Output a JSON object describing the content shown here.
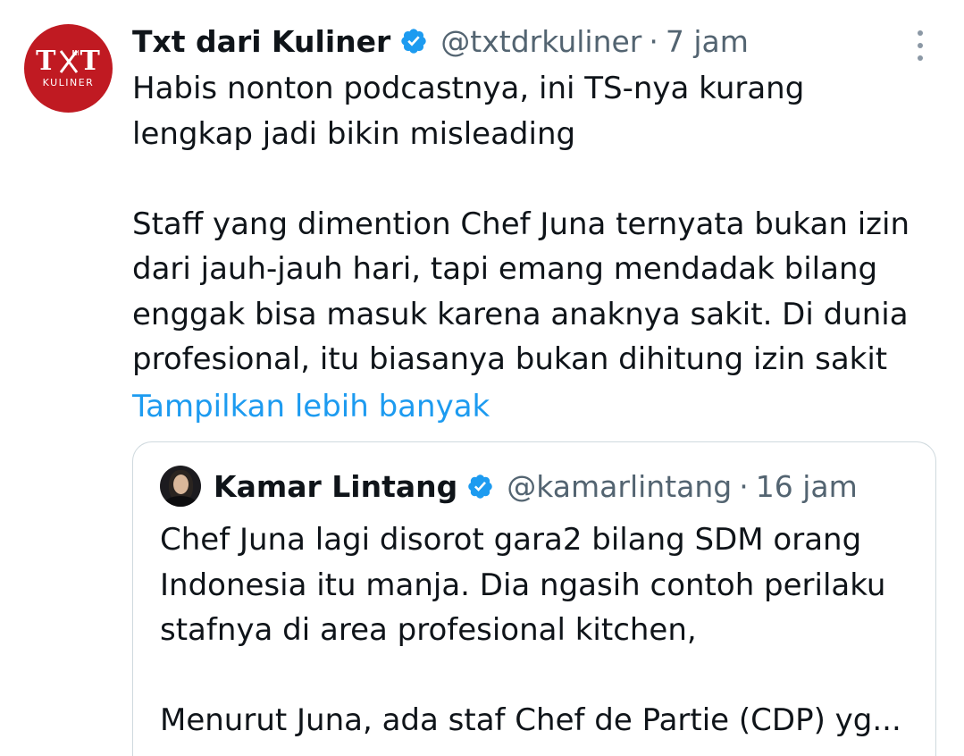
{
  "tweet": {
    "avatar": {
      "logo_top": "TXT",
      "logo_sub": "KULINER",
      "icon": "fork-icon"
    },
    "display_name": "Txt dari Kuliner",
    "verified_icon": "verified-badge-icon",
    "handle": "@txtdrkuliner",
    "separator": "·",
    "time": "7 jam",
    "more_icon": "more-vertical-icon",
    "lines": [
      "Habis nonton podcastnya, ini TS-nya kurang",
      "lengkap jadi bikin misleading",
      "Staff yang dimention Chef Juna ternyata bukan izin",
      "dari jauh-jauh hari, tapi emang mendadak bilang",
      "enggak bisa masuk karena anaknya sakit. Di dunia",
      "profesional, itu biasanya bukan dihitung izin sakit"
    ],
    "show_more": "Tampilkan lebih banyak"
  },
  "quote": {
    "display_name": "Kamar Lintang",
    "handle": "@kamarlintang",
    "separator": "·",
    "time": "16 jam",
    "lines": [
      "Chef Juna lagi disorot gara2 bilang SDM orang",
      "Indonesia itu manja. Dia ngasih contoh perilaku",
      "stafnya di area profesional kitchen,",
      "Menurut Juna, ada staf Chef de Partie (CDP) yg..."
    ]
  },
  "colors": {
    "brand_red": "#c01a22",
    "link_blue": "#1d9bf0",
    "secondary_text": "#536471",
    "border": "#cfd9de"
  }
}
